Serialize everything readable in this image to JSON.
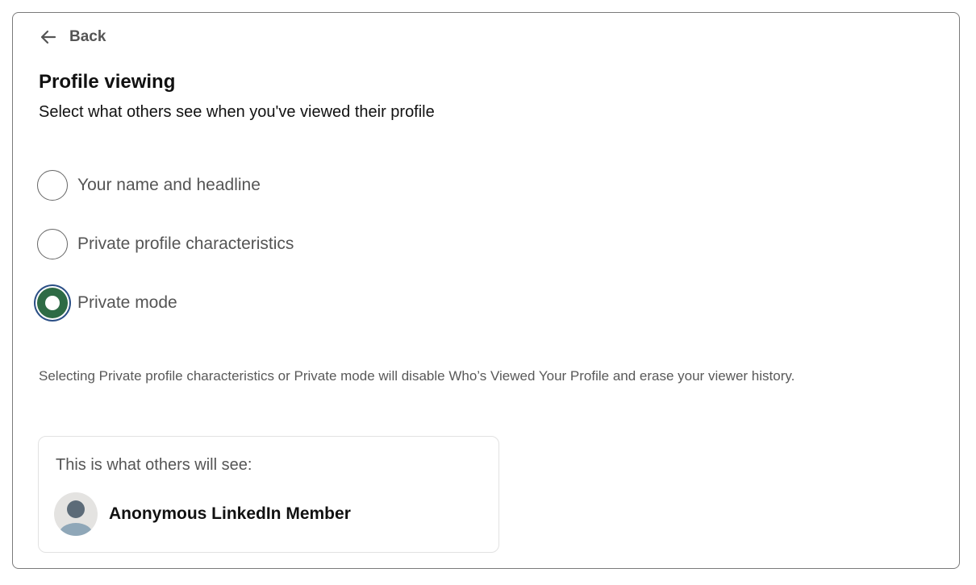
{
  "header": {
    "back_label": "Back",
    "back_icon": "arrow-left-icon"
  },
  "title": "Profile viewing",
  "subtitle": "Select what others see when you've viewed their profile",
  "options": [
    {
      "label": "Your name and headline",
      "selected": false
    },
    {
      "label": "Private profile characteristics",
      "selected": false
    },
    {
      "label": "Private mode",
      "selected": true
    }
  ],
  "disclaimer": "Selecting Private profile characteristics or Private mode will disable Who’s Viewed Your Profile and erase your viewer history.",
  "preview": {
    "label": "This is what others will see:",
    "member_name": "Anonymous LinkedIn Member",
    "avatar_icon": "anonymous-avatar-icon"
  },
  "colors": {
    "selected_fill": "#2e6b45",
    "focus_ring": "#2b4f86"
  }
}
